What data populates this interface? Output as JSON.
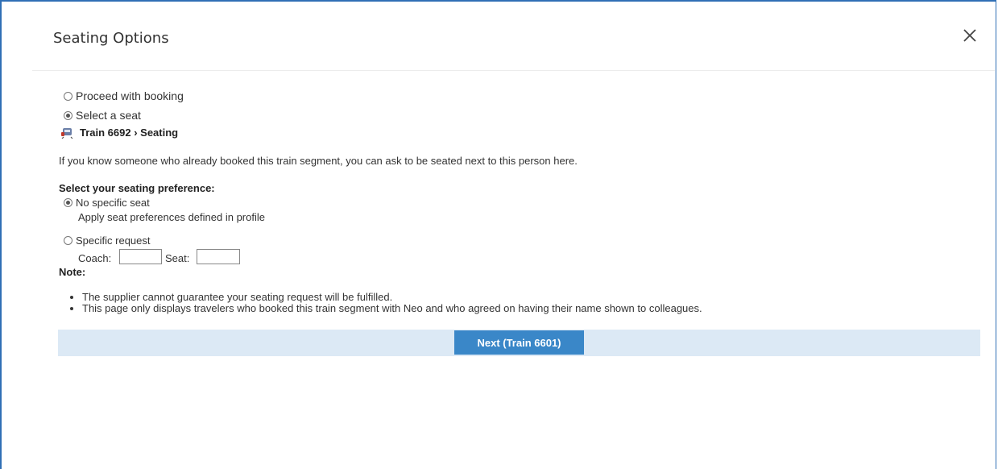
{
  "dialog": {
    "title": "Seating Options",
    "close_icon": "close-icon"
  },
  "booking_options": [
    {
      "label": "Proceed with booking",
      "checked": false
    },
    {
      "label": "Select a seat",
      "checked": true
    }
  ],
  "breadcrumb": {
    "icon": "train-icon",
    "text": "Train 6692 › Seating"
  },
  "intro_text": "If you know someone who already booked this train segment, you can ask to be seated next to this person here.",
  "preference": {
    "heading": "Select your seating preference:",
    "no_specific": {
      "label": "No specific seat",
      "description": "Apply seat preferences defined in profile",
      "checked": true
    },
    "specific": {
      "label": "Specific request",
      "checked": false,
      "coach_label": "Coach:",
      "coach_value": "",
      "seat_label": "Seat:",
      "seat_value": ""
    }
  },
  "note": {
    "heading": "Note:",
    "items": [
      "The supplier cannot guarantee your seating request will be fulfilled.",
      "This page only displays travelers who booked this train segment with Neo and who agreed on having their name shown to colleagues."
    ]
  },
  "actions": {
    "next_label": "Next (Train 6601)"
  },
  "colors": {
    "accent": "#3a87c8",
    "action_bar": "#dce9f5",
    "frame_border": "#2f6fb5"
  }
}
